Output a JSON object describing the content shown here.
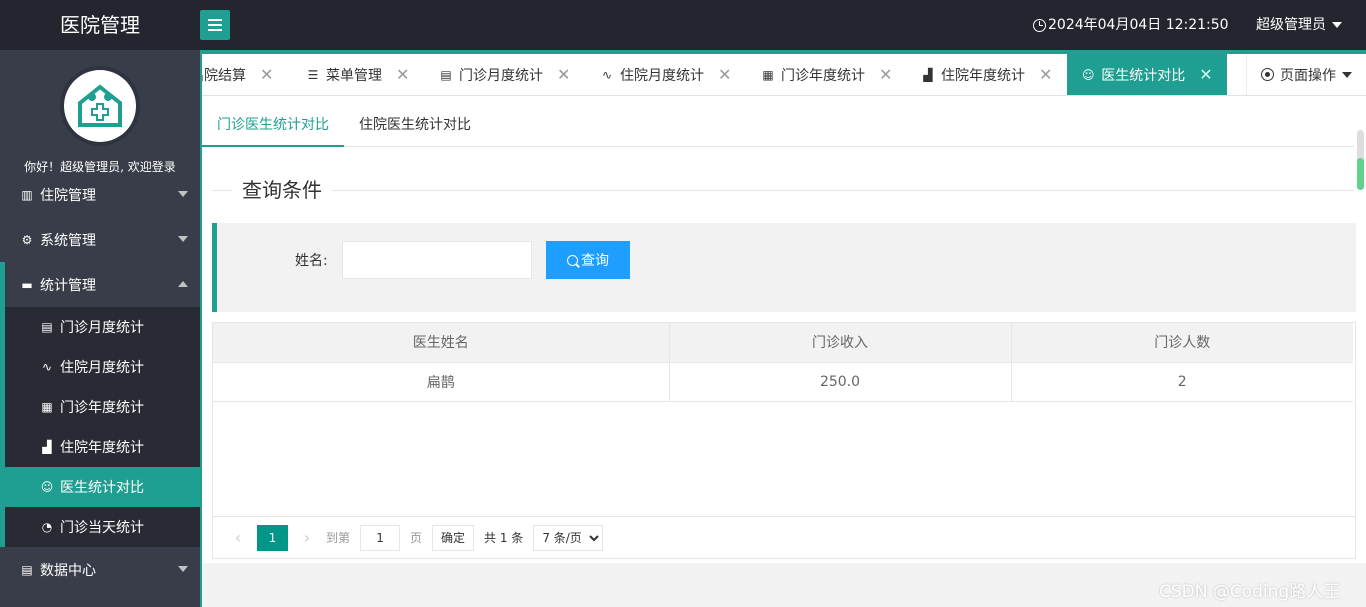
{
  "header": {
    "app_title": "医院管理",
    "datetime": "2024年04月04日 12:21:50",
    "user": "超级管理员"
  },
  "sidebar": {
    "welcome": "你好！超级管理员, 欢迎登录",
    "nav": [
      {
        "label": "住院管理",
        "icon": "ward-icon"
      },
      {
        "label": "系统管理",
        "icon": "gear-icon"
      },
      {
        "label": "统计管理",
        "icon": "monitor-icon"
      },
      {
        "label": "数据中心",
        "icon": "document-icon"
      }
    ],
    "sub_items": [
      {
        "label": "门诊月度统计",
        "icon": "clipboard-icon"
      },
      {
        "label": "住院月度统计",
        "icon": "pulse-icon"
      },
      {
        "label": "门诊年度统计",
        "icon": "table-icon"
      },
      {
        "label": "住院年度统计",
        "icon": "building-icon"
      },
      {
        "label": "医生统计对比",
        "icon": "user-icon"
      },
      {
        "label": "门诊当天统计",
        "icon": "clock-icon"
      }
    ]
  },
  "tabs": [
    {
      "label": "出院结算"
    },
    {
      "label": "菜单管理",
      "icon": "circle-menu-icon"
    },
    {
      "label": "门诊月度统计",
      "icon": "clipboard-icon"
    },
    {
      "label": "住院月度统计",
      "icon": "pulse-icon"
    },
    {
      "label": "门诊年度统计",
      "icon": "table-icon"
    },
    {
      "label": "住院年度统计",
      "icon": "building-icon"
    },
    {
      "label": "医生统计对比",
      "icon": "user-icon"
    }
  ],
  "page_ops": "页面操作",
  "subtabs": [
    "门诊医生统计对比",
    "住院医生统计对比"
  ],
  "query": {
    "legend": "查询条件",
    "name_label": "姓名:",
    "name_value": "",
    "button": "查询"
  },
  "table": {
    "headers": [
      "医生姓名",
      "门诊收入",
      "门诊人数"
    ],
    "rows": [
      [
        "扁鹊",
        "250.0",
        "2"
      ]
    ]
  },
  "pager": {
    "current_page": "1",
    "goto_label": "到第",
    "goto_value": "1",
    "page_suffix": "页",
    "confirm": "确定",
    "total": "共 1 条",
    "page_size": "7 条/页"
  },
  "watermark": "CSDN @Coding路人王",
  "colors": {
    "accent": "#1e9f91",
    "header_bg": "#23262e",
    "sidebar_bg": "#393d49",
    "primary_button": "#1e9fff"
  }
}
